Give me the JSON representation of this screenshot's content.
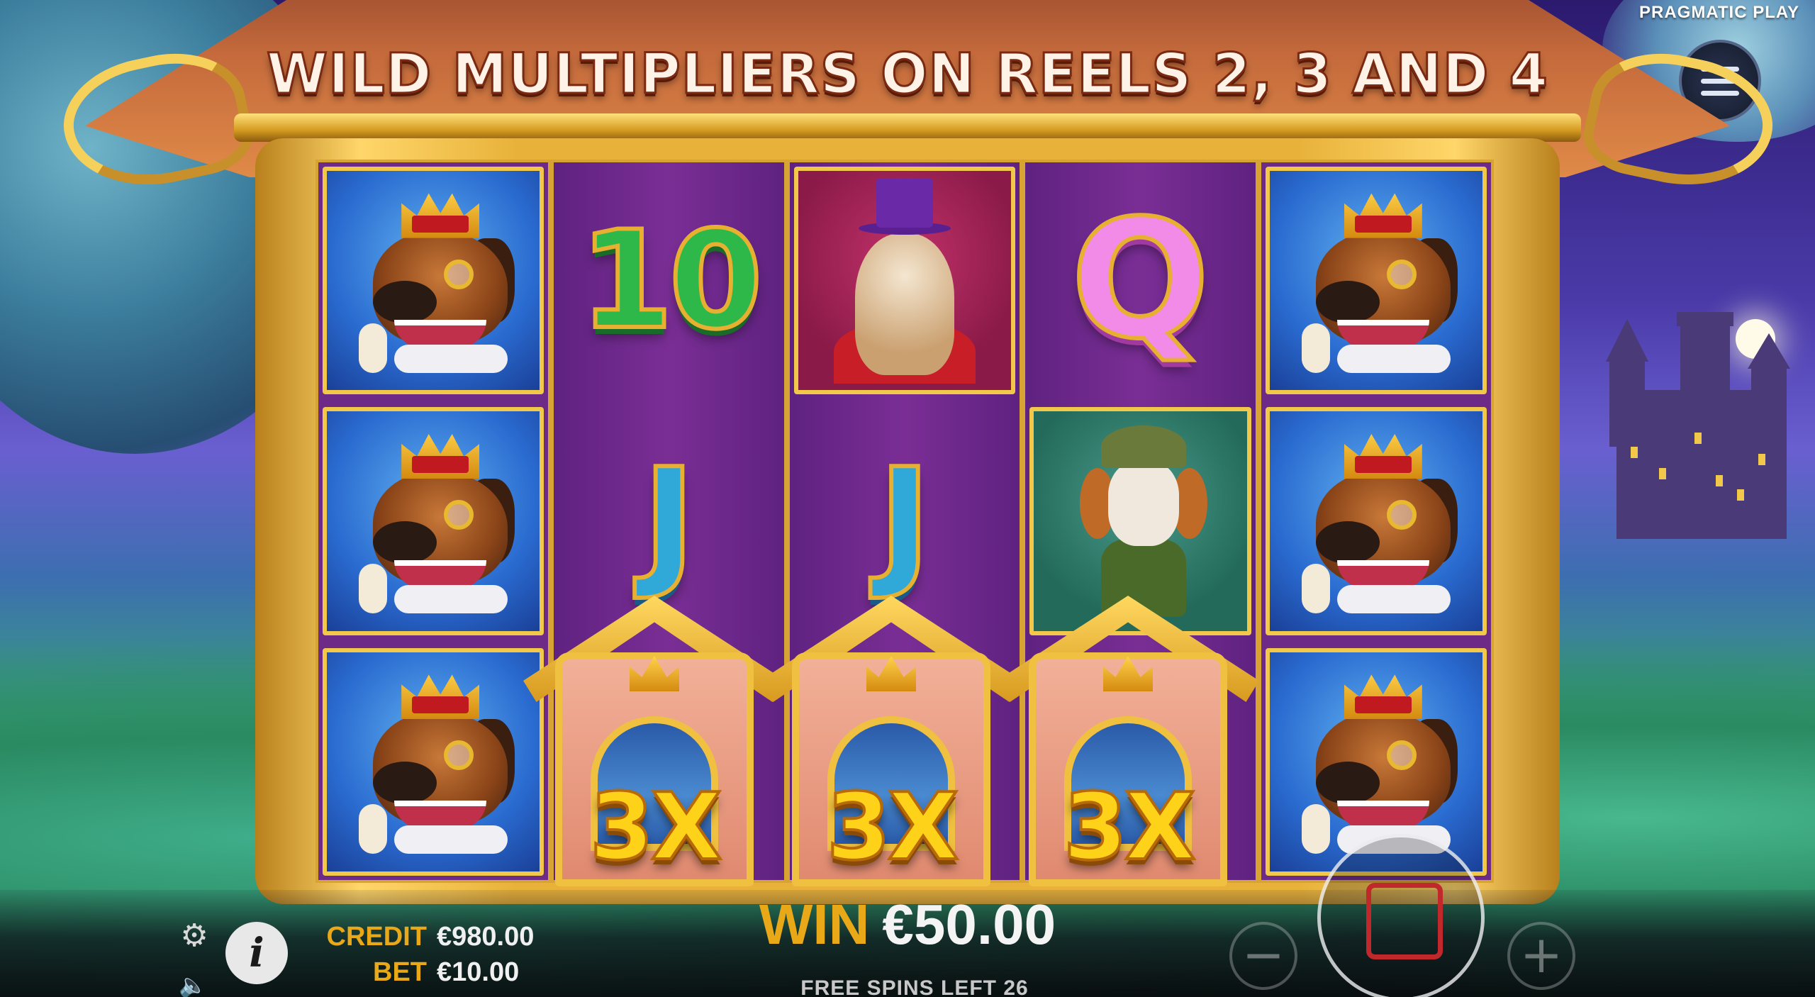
{
  "game": {
    "provider": "PRAGMATIC PLAY",
    "banner": "WILD MULTIPLIERS ON REELS 2, 3 AND 4"
  },
  "reels": [
    {
      "symbols": [
        "dog-king",
        "dog-king",
        "dog-king"
      ]
    },
    {
      "symbols": [
        "10",
        "J",
        "wild"
      ]
    },
    {
      "symbols": [
        "yorkie",
        "J",
        "wild"
      ]
    },
    {
      "symbols": [
        "Q",
        "hound",
        "wild"
      ]
    },
    {
      "symbols": [
        "dog-king",
        "dog-king",
        "dog-king"
      ]
    }
  ],
  "symbols": {
    "ten": "10",
    "queen": "Q",
    "jack": "J"
  },
  "wilds": [
    {
      "reel": 2,
      "multiplier": "3X"
    },
    {
      "reel": 3,
      "multiplier": "3X"
    },
    {
      "reel": 4,
      "multiplier": "3X"
    }
  ],
  "hud": {
    "credit_label": "CREDIT",
    "credit_value": "€980.00",
    "bet_label": "BET",
    "bet_value": "€10.00",
    "win_label": "WIN",
    "win_value": "€50.00",
    "free_spins": "FREE SPINS LEFT 26",
    "info_label": "i",
    "minus_label": "−",
    "plus_label": "+"
  },
  "icons": {
    "menu": "hamburger-icon",
    "settings": "gear-icon",
    "info": "info-icon",
    "sound": "speaker-icon",
    "stop": "stop-icon"
  },
  "colors": {
    "accent_gold": "#e8a818",
    "frame_gold": "#f2c84a",
    "reel_purple": "#6d2a86",
    "stop_red": "#c0282c"
  }
}
